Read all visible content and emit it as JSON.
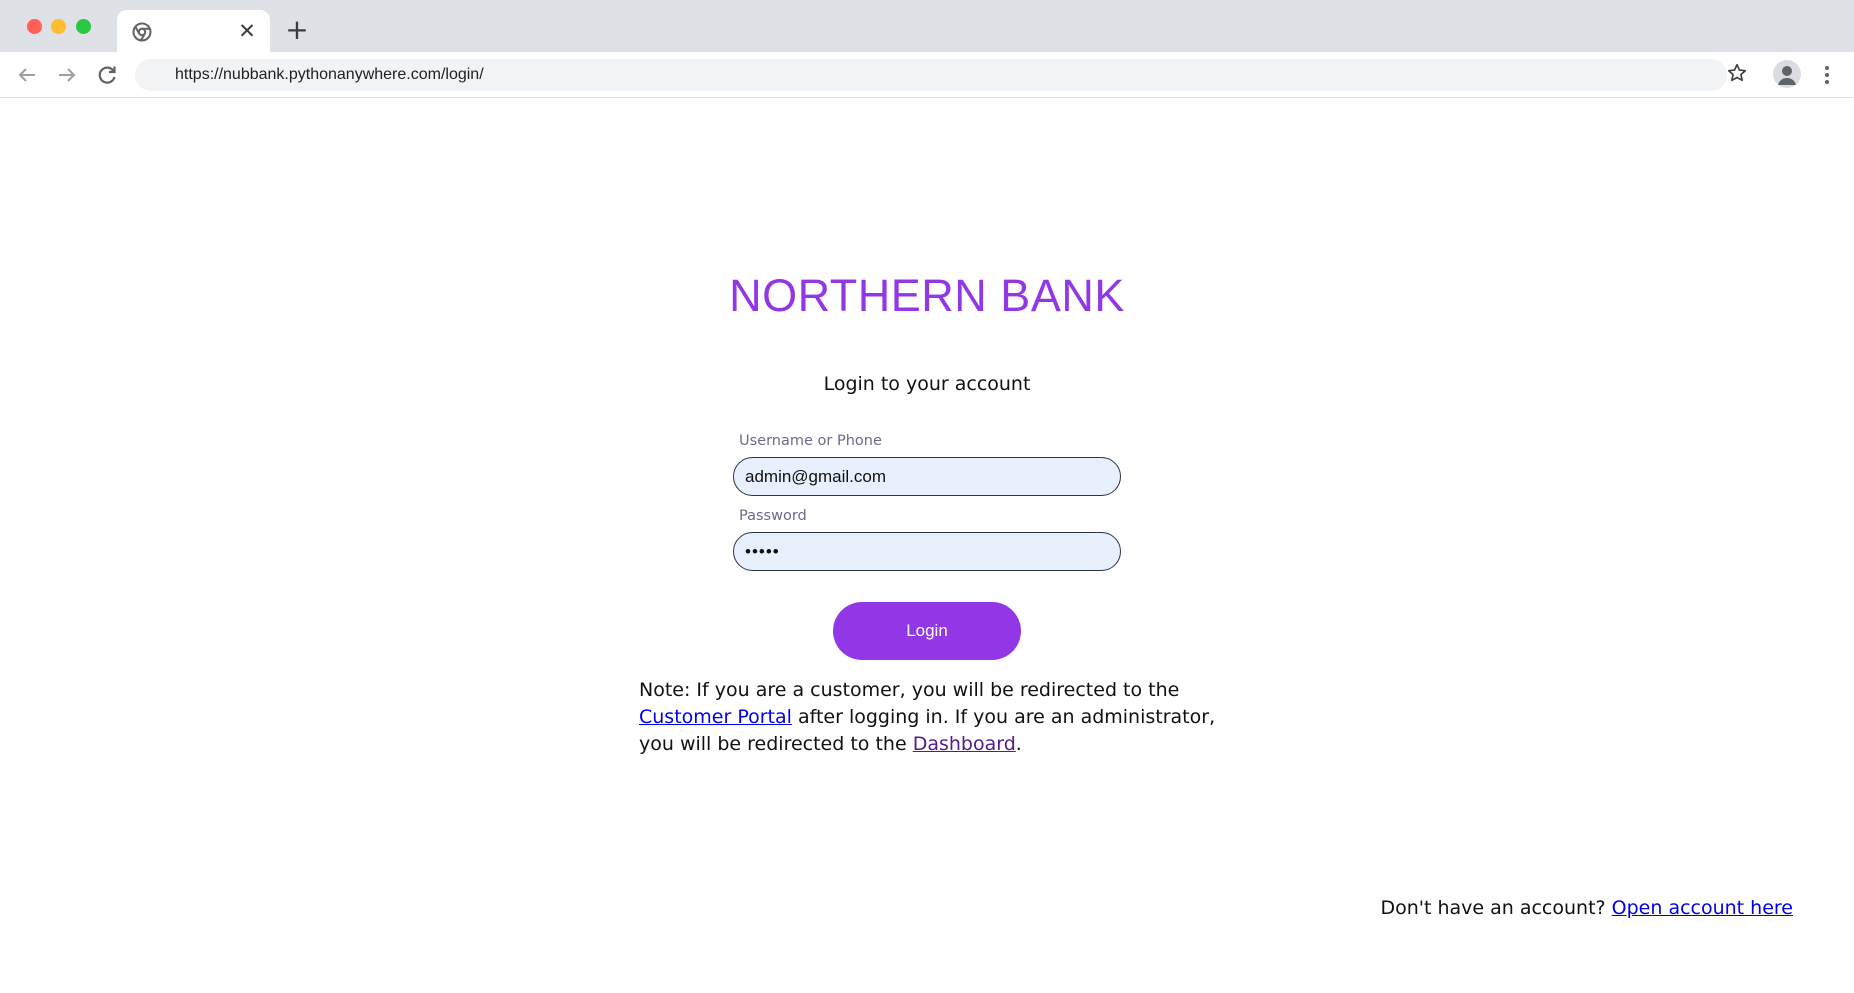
{
  "browser": {
    "url": "https://nubbank.pythonanywhere.com/login/",
    "tab_close": "✕",
    "new_tab": "+",
    "icons": {
      "favicon": "chrome-icon",
      "back": "arrow-left-icon",
      "forward": "arrow-right-icon",
      "reload": "reload-icon",
      "bookmark": "star-icon",
      "profile": "profile-icon",
      "menu": "kebab-menu-icon"
    }
  },
  "page": {
    "brand": "NORTHERN BANK",
    "subtitle": "Login to your account",
    "form": {
      "username_label": "Username or Phone",
      "username_value": "admin@gmail.com",
      "password_label": "Password",
      "password_value": "•••••",
      "login_label": "Login"
    },
    "note": {
      "part1": "Note: If you are a customer, you will be redirected to the ",
      "link1": "Customer Portal",
      "part2": " after logging in. If you are an administrator, you will be redirected to the ",
      "link2": "Dashboard",
      "part3": "."
    },
    "signup": {
      "text": "Don't have an account? ",
      "link": "Open account here"
    }
  },
  "colors": {
    "brand": "#9237e6",
    "input_bg": "#e8f0fe",
    "link": "#0000ee",
    "link_visited": "#551a8b"
  }
}
